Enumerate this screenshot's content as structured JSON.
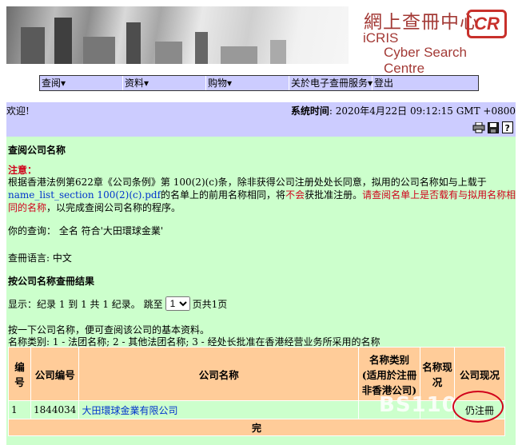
{
  "banner": {
    "title_cn": "網上查冊中心",
    "title_icris": "iCRIS",
    "title_en": "Cyber Search Centre",
    "logo": "CR"
  },
  "menu": [
    "查阅",
    "资料",
    "购物",
    "关於电子查冊服务",
    "登出"
  ],
  "welcome": {
    "greeting": "欢迎!",
    "time_label": "系统时间",
    "time_value": ": 2020年4月22日 09:12:15 GMT +0800"
  },
  "tool_icons": [
    "printer-icon",
    "save-icon",
    "help-icon"
  ],
  "main": {
    "heading": "查阅公司名称",
    "notice_label": "注意：",
    "notice_1": "根据香港法例第622章《公司条例》第 100(2)(c)条，除非获得公司注册处处长同意，拟用的公司名称如与上载于",
    "notice_link": "name_list_section 100(2)(c).pdf",
    "notice_2a": "的名单上的前用名称相同，将",
    "notice_2b": "不会",
    "notice_2c": "获批准注册。",
    "notice_2d": "请查阅名单上是否载有与拟用名称相",
    "notice_3a": "同的名称",
    "notice_3b": "，以完成查阅公司名称的程序。",
    "query": "你的查询： 全名 符合'大田環球金業'",
    "language": "查冊语言: 中文",
    "results_heading": "按公司名称查冊结果",
    "display_a": "显示：纪录 1 到 1 共 1 纪录。 跳至",
    "page_select": "1",
    "display_b": "页共1页",
    "hint": "按一下公司名称，便可查阅该公司的基本资料。",
    "categories": "名称类别: 1 - 法团名称; 2 - 其他法团名称; 3 - 经处长批准在香港经营业务所采用的名称"
  },
  "table": {
    "headers": [
      "编号",
      "公司编号",
      "公司名称",
      "名称类别 (适用於注冊非香港公司)",
      "名称现况",
      "公司现况"
    ],
    "rows": [
      [
        "1",
        "1844034",
        "大田環球金業有限公司",
        "",
        "",
        "仍注冊"
      ]
    ],
    "footer": "完"
  },
  "watermark": "BS110"
}
